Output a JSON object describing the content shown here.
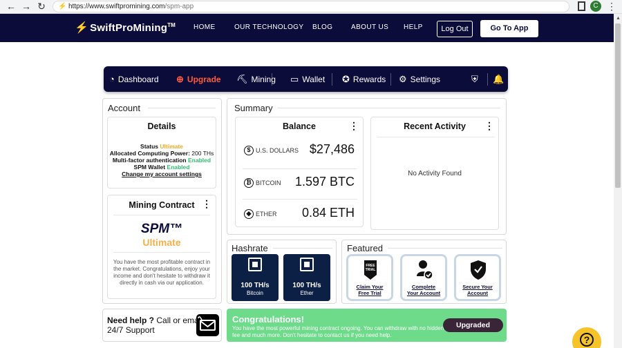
{
  "browser": {
    "url_host": "https://www.swiftpromining.com",
    "url_path": "/spm-app",
    "profile_initial": "C"
  },
  "header": {
    "logo_text": "SwiftProMining",
    "logo_tm": "TM",
    "nav": [
      "HOME",
      "OUR TECHNOLOGY",
      "BLOG",
      "ABOUT US",
      "HELP"
    ],
    "logout_label": "Log Out",
    "goapp_label": "Go To App"
  },
  "appnav": {
    "items": [
      {
        "label": "Dashboard",
        "icon": "speedometer-icon"
      },
      {
        "label": "Upgrade",
        "icon": "upgrade-icon",
        "active": true
      },
      {
        "label": "Mining",
        "icon": "pickaxe-icon"
      },
      {
        "label": "Wallet",
        "icon": "wallet-icon"
      },
      {
        "label": "Rewards",
        "icon": "medal-icon"
      },
      {
        "label": "Settings",
        "icon": "gear-icon"
      }
    ],
    "active_color": "#ff5a3c"
  },
  "account": {
    "title": "Account",
    "details_title": "Details",
    "status_label": "Status",
    "status_value": "Ultimate",
    "power_label": "Allocated Computing Power",
    "power_value": "200 TH",
    "power_unit": "s",
    "mfa_label": "Multi-factor authentication",
    "mfa_value": "Enabled",
    "wallet_label": "SPM Wallet",
    "wallet_value": "Enabled",
    "settings_link": "Change my account settings",
    "contract_title": "Mining Contract",
    "contract_name": "SPM™",
    "contract_tier": "Ultimate",
    "contract_text": "You have the most profitable contract in the market. Congratulations, enjoy your income and don't hesitate to withdraw it directly in cash via our application."
  },
  "summary": {
    "title": "Summary",
    "balance_title": "Balance",
    "balances": [
      {
        "symbol": "$",
        "currency": "U.S. DOLLARS",
        "amount": "$27,486"
      },
      {
        "symbol": "₿",
        "currency": "BITCOIN",
        "amount": "1.597 BTC"
      },
      {
        "symbol": "◆",
        "currency": "ETHER",
        "amount": "0.84 ETH"
      }
    ],
    "activity_title": "Recent Activity",
    "activity_empty": "No Activity Found"
  },
  "hashrate": {
    "title": "Hashrate",
    "tiles": [
      {
        "value": "100 TH/s",
        "name": "Bitcoin"
      },
      {
        "value": "100 TH/s",
        "name": "Ether"
      }
    ]
  },
  "featured": {
    "title": "Featured",
    "tiles": [
      {
        "line1": "Claim Your",
        "line2": "Free Trial",
        "icon_text": "FREE TRIAL"
      },
      {
        "line1": "Complete",
        "line2": "Your Account"
      },
      {
        "line1": "Secure Your",
        "line2": "Account"
      }
    ]
  },
  "help": {
    "bold": "Need help ?",
    "rest": " Call or email us! 24/7 Support"
  },
  "congrats": {
    "title": "Congratulations!",
    "body": "You have the most powerful mining contract ongoing. You can withdraw with no hidden fee and much more. Don't hesitate to contact us if you need help.",
    "button": "Upgraded"
  },
  "colors": {
    "navy": "#0c0c3a",
    "orange": "#f6a821",
    "green": "#2fbf71",
    "congrats_bg": "#6ddb8a",
    "help_fab": "#f6c32b"
  }
}
